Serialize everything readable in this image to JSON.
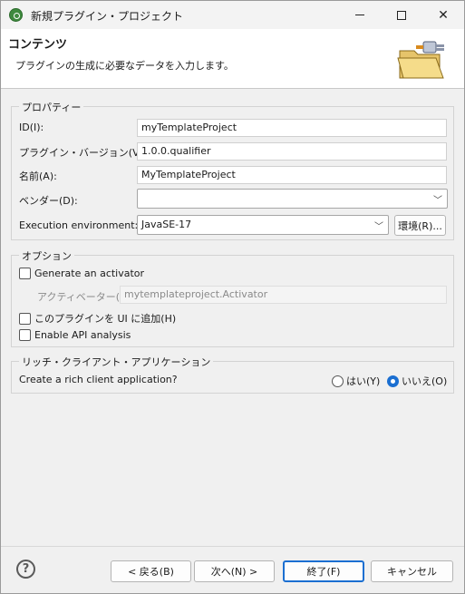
{
  "window": {
    "title": "新規プラグイン・プロジェクト",
    "minimize_glyph": "—",
    "close_glyph": "✕"
  },
  "banner": {
    "title": "コンテンツ",
    "description": "プラグインの生成に必要なデータを入力します。",
    "image_icon": "plugin-folder-wizard-icon"
  },
  "properties": {
    "group_label": "プロパティー",
    "id_label": "ID(I):",
    "id_value": "myTemplateProject",
    "version_label": "プラグイン・バージョン(V):",
    "version_value": "1.0.0.qualifier",
    "name_label": "名前(A):",
    "name_value": "MyTemplateProject",
    "vendor_label": "ベンダー(D):",
    "vendor_value": "",
    "exec_env_label": "Execution environment:",
    "exec_env_value": "JavaSE-17",
    "environments_button": "環境(R)..."
  },
  "options": {
    "group_label": "オプション",
    "generate_activator_label": "Generate an activator",
    "generate_activator_checked": false,
    "activator_label": "アクティベーター(T):",
    "activator_value": "mytemplateproject.Activator",
    "ui_contribution_label": "このプラグインを UI に追加(H)",
    "ui_contribution_checked": false,
    "api_analysis_label": "Enable API analysis",
    "api_analysis_checked": false
  },
  "rcp": {
    "group_label": "リッチ・クライアント・アプリケーション",
    "question": "Create a rich client application?",
    "yes_label": "はい(Y)",
    "no_label": "いいえ(O)",
    "selected": "no"
  },
  "footer": {
    "help_glyph": "?",
    "back_button": "< 戻る(B)",
    "next_button": "次へ(N) >",
    "finish_button": "終了(F)",
    "cancel_button": "キャンセル"
  },
  "colors": {
    "accent": "#1b6fd1",
    "banner_bg": "#ffffff",
    "window_bg": "#f0f0f0"
  }
}
